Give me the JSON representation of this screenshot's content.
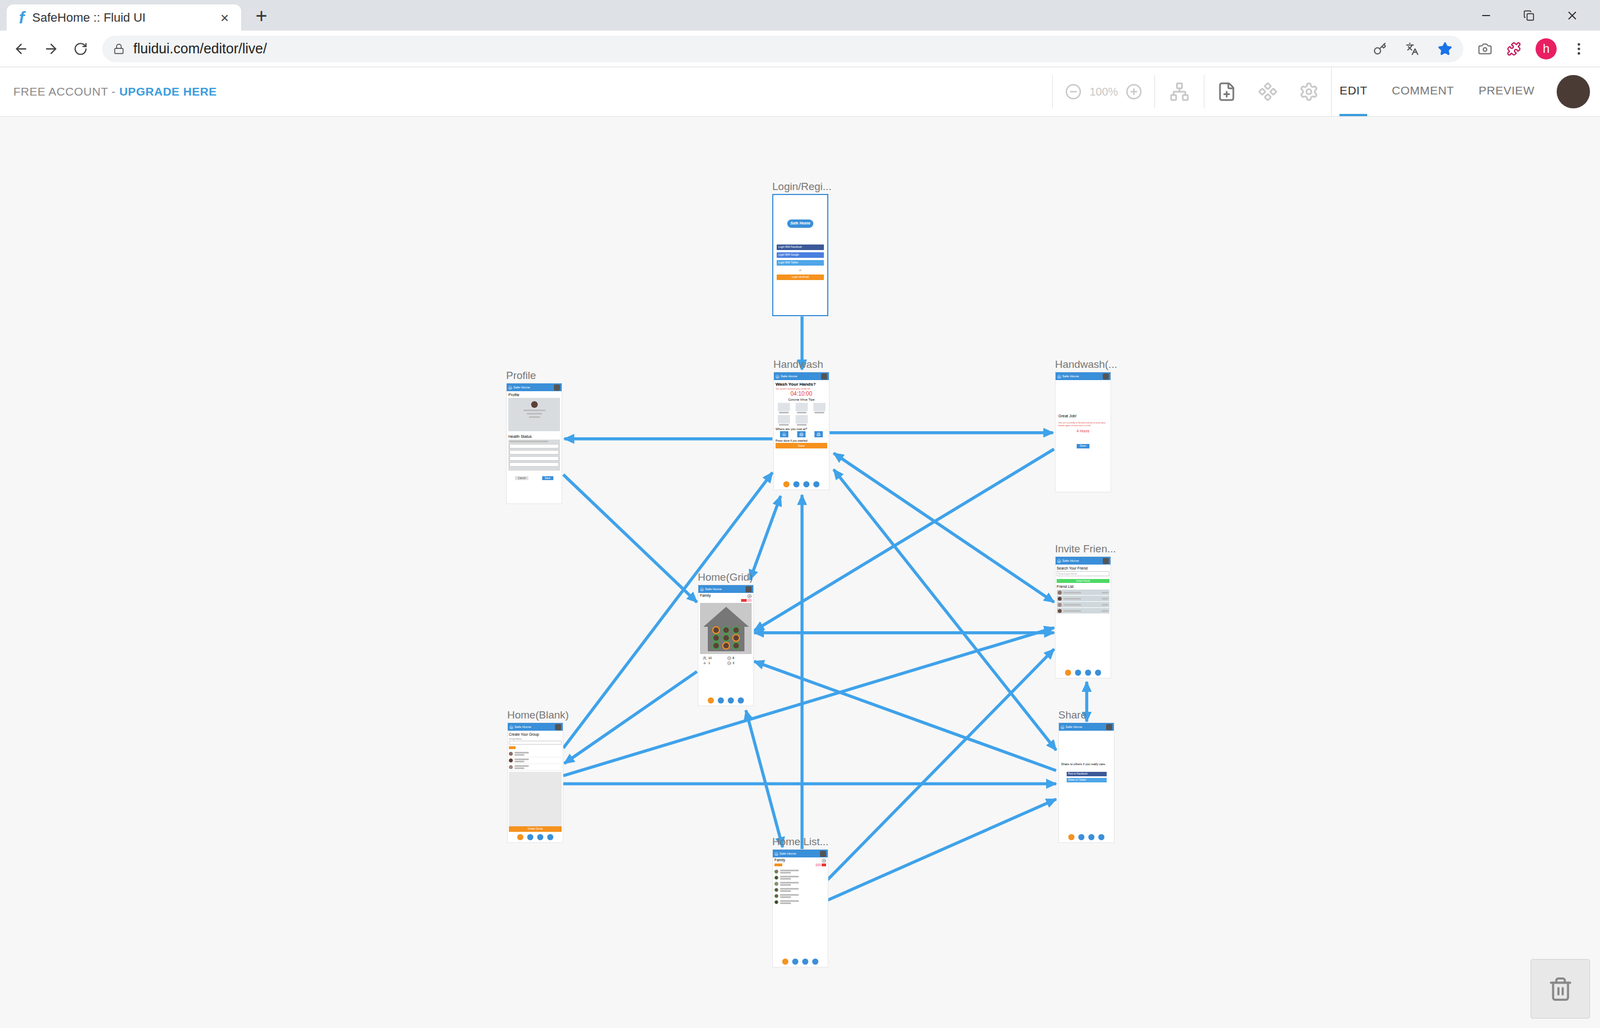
{
  "browser": {
    "tab": {
      "favicon": "f",
      "title": "SafeHome :: Fluid UI",
      "close": "×"
    },
    "new_tab": "+",
    "url": "fluidui.com/editor/live/",
    "profile_initial": "h",
    "bookmarked": true
  },
  "toolbar": {
    "account": "FREE ACCOUNT - ",
    "upgrade": "UPGRADE HERE",
    "zoom": {
      "value": "100%",
      "disabled": true
    },
    "modes": [
      {
        "label": "EDIT",
        "selected": true
      },
      {
        "label": "COMMENT",
        "selected": false
      },
      {
        "label": "PREVIEW",
        "selected": false
      }
    ]
  },
  "app_header": "Safe Home",
  "screens": [
    {
      "key": "login",
      "kind": "login",
      "label": "Login/Regi...",
      "selected": true,
      "logo": "Safe Home",
      "buttons": [
        {
          "text": "Login With Facebook",
          "color": "#3b5998"
        },
        {
          "text": "Login With Google",
          "color": "#4a7fe0"
        },
        {
          "text": "Login With Twitter",
          "color": "#4ea6e8"
        }
      ],
      "separator": "or",
      "email_button": "Login via Email"
    },
    {
      "key": "handwash",
      "kind": "handwash",
      "label": "Handwash",
      "selected": false,
      "title": "Wash Your Hands?",
      "warning": "You haven't washed your hands for:",
      "timer": "04:10:00",
      "tips_title": "Corona Virus Tips",
      "location_title": "Where are you now at?",
      "prompt": "Press done if you washed",
      "done": "Done",
      "nav": [
        {
          "selected": true
        },
        {
          "selected": false
        },
        {
          "selected": false
        },
        {
          "selected": false
        }
      ]
    },
    {
      "key": "handwash2",
      "kind": "greatjob",
      "label": "Handwash(...",
      "selected": false,
      "title": "Great Job!",
      "message": "You are currently at School and try to wash your hands again at least once in next",
      "hours": "4 Hours",
      "button": "Done"
    },
    {
      "key": "profile",
      "kind": "profile",
      "label": "Profile",
      "selected": false,
      "title": "Profile",
      "health_title": "Health Status",
      "buttons": [
        "Cancel",
        "Save"
      ]
    },
    {
      "key": "homeGrid",
      "kind": "homegrid",
      "label": "Home(Grid)",
      "selected": false,
      "group": "Family",
      "stats": [
        "10",
        "8",
        "1",
        "3"
      ],
      "nav": [
        {
          "selected": true
        },
        {
          "selected": false
        },
        {
          "selected": false
        },
        {
          "selected": false
        }
      ]
    },
    {
      "key": "invite",
      "kind": "invite",
      "label": "Invite Frien...",
      "selected": false,
      "title": "Search Your Friend",
      "placeholder": "Search your friend",
      "button": "Invite Friend",
      "list_title": "Friend List",
      "nav": [
        {
          "selected": true
        },
        {
          "selected": false
        },
        {
          "selected": false
        },
        {
          "selected": false
        }
      ]
    },
    {
      "key": "homeBlank",
      "kind": "homeblank",
      "label": "Home(Blank)",
      "selected": false,
      "title": "Create Your Group",
      "field_label": "Group Name",
      "button": "Create Group",
      "nav": [
        {
          "selected": true
        },
        {
          "selected": false
        },
        {
          "selected": false
        },
        {
          "selected": false
        }
      ]
    },
    {
      "key": "share",
      "kind": "share",
      "label": "Share",
      "selected": false,
      "message": "Share to others if you really care.",
      "buttons": [
        {
          "text": "Post to Facebook",
          "color": "#3b5998"
        },
        {
          "text": "Share on Twitter",
          "color": "#4ea6e8"
        }
      ],
      "nav": [
        {
          "selected": true
        },
        {
          "selected": false
        },
        {
          "selected": false
        },
        {
          "selected": false
        }
      ]
    },
    {
      "key": "homeList",
      "kind": "homelist",
      "label": "Home List...",
      "selected": false,
      "group": "Family",
      "nav": [
        {
          "selected": true
        },
        {
          "selected": false
        },
        {
          "selected": false
        },
        {
          "selected": false
        }
      ]
    }
  ]
}
